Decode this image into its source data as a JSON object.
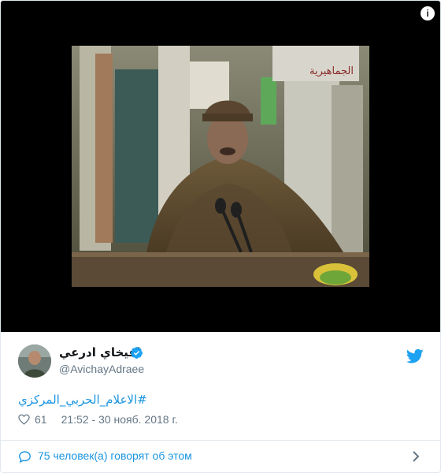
{
  "tweet": {
    "author": {
      "display_name": "افيخاي ادرعي",
      "handle": "@AvichayAdraee",
      "verified": true
    },
    "text": "#الاعلام_الحربي_المركزي",
    "likes": "61",
    "timestamp": "21:52 - 30 нояб. 2018 г.",
    "conversation_text": "75 человек(а) говорят об этом",
    "media": {
      "info_label": "i",
      "channel_logo_text": "الجماهيرية"
    }
  },
  "colors": {
    "link": "#1b95e0",
    "muted": "#657786",
    "text": "#14171a",
    "border": "#e1e8ed",
    "media_background": "#000000"
  },
  "icons": [
    "info-icon",
    "verified-badge-icon",
    "twitter-bird-icon",
    "heart-icon",
    "speech-bubble-icon",
    "chevron-right-icon"
  ]
}
